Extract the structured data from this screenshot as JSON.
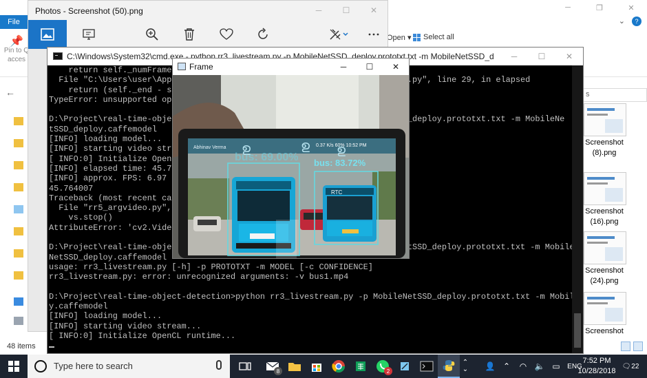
{
  "explorer": {
    "file_tab": "File",
    "pin_label_1": "Pin to Q",
    "pin_label_2": "acces",
    "open_label": "Open ▾",
    "select_all": "Select all",
    "item_count": "48 items",
    "thumbnails": [
      {
        "label_1": "Screenshot",
        "label_2": "(8).png"
      },
      {
        "label_1": "Screenshot",
        "label_2": "(16).png"
      },
      {
        "label_1": "Screenshot",
        "label_2": "(24).png"
      },
      {
        "label_1": "Screenshot",
        "label_2": ""
      }
    ],
    "search_fragment": "s"
  },
  "photos": {
    "title": "Photos - Screenshot (50).png",
    "toolbar": {
      "view": "photo-icon",
      "slideshow": "slideshow-icon",
      "zoom": "zoom-in-icon",
      "delete": "trash-icon",
      "favorite": "heart-icon",
      "rotate": "rotate-icon",
      "edit": "edit-icon",
      "more": "more-icon"
    }
  },
  "cmd": {
    "title": "C:\\Windows\\System32\\cmd.exe - python  rr3_livestream.py -p MobileNetSSD_deploy.prototxt.txt -m MobileNetSSD_deploy.caffemodel",
    "lines": [
      "    return self._numFrames /",
      "  File \"C:\\Users\\user\\AppDat                                          fps.py\", line 29, in elapsed",
      "    return (self._end - self",
      "TypeError: unsupported opera",
      "",
      "D:\\Project\\real-time-object-                                       NetSSD_deploy.prototxt.txt -m MobileNe",
      "tSSD_deploy.caffemodel",
      "[INFO] loading model...",
      "[INFO] starting video stream",
      "[ INFO:0] Initialize OpenCL",
      "[INFO] elapsed time: 45.76",
      "[INFO] approx. FPS: 6.97",
      "45.764007",
      "Traceback (most recent call",
      "  File \"rr5_argvideo.py\", li",
      "    vs.stop()",
      "AttributeError: 'cv2.VideoCa",
      "",
      "D:\\Project\\real-time-object-                                       bileNetSSD_deploy.prototxt.txt -m Mobile",
      "NetSSD_deploy.caffemodel",
      "usage: rr3_livestream.py [-h] -p PROTOTXT -m MODEL [-c CONFIDENCE]",
      "rr3_livestream.py: error: unrecognized arguments: -v bus1.mp4",
      "",
      "D:\\Project\\real-time-object-detection>python rr3_livestream.py -p MobileNetSSD_deploy.prototxt.txt -m MobileNetSSD_deplo",
      "y.caffemodel",
      "[INFO] loading model...",
      "[INFO] starting video stream...",
      "[ INFO:0] Initialize OpenCL runtime..."
    ]
  },
  "frame": {
    "title": "Frame",
    "detection_label": "bus: 83.72%",
    "detection_label_faded": "bus: 69.00%",
    "phone_status": "0.37 K/s    60%  10:52 PM",
    "bus_sign": "RTC",
    "phone_header": "Abhinav Vermа"
  },
  "taskbar": {
    "search_placeholder": "Type here to search",
    "time": "7:52 PM",
    "date": "10/28/2018",
    "notification_count": "22",
    "mail_badge": "8",
    "whatsapp_badge": "2",
    "language": "ENG"
  }
}
